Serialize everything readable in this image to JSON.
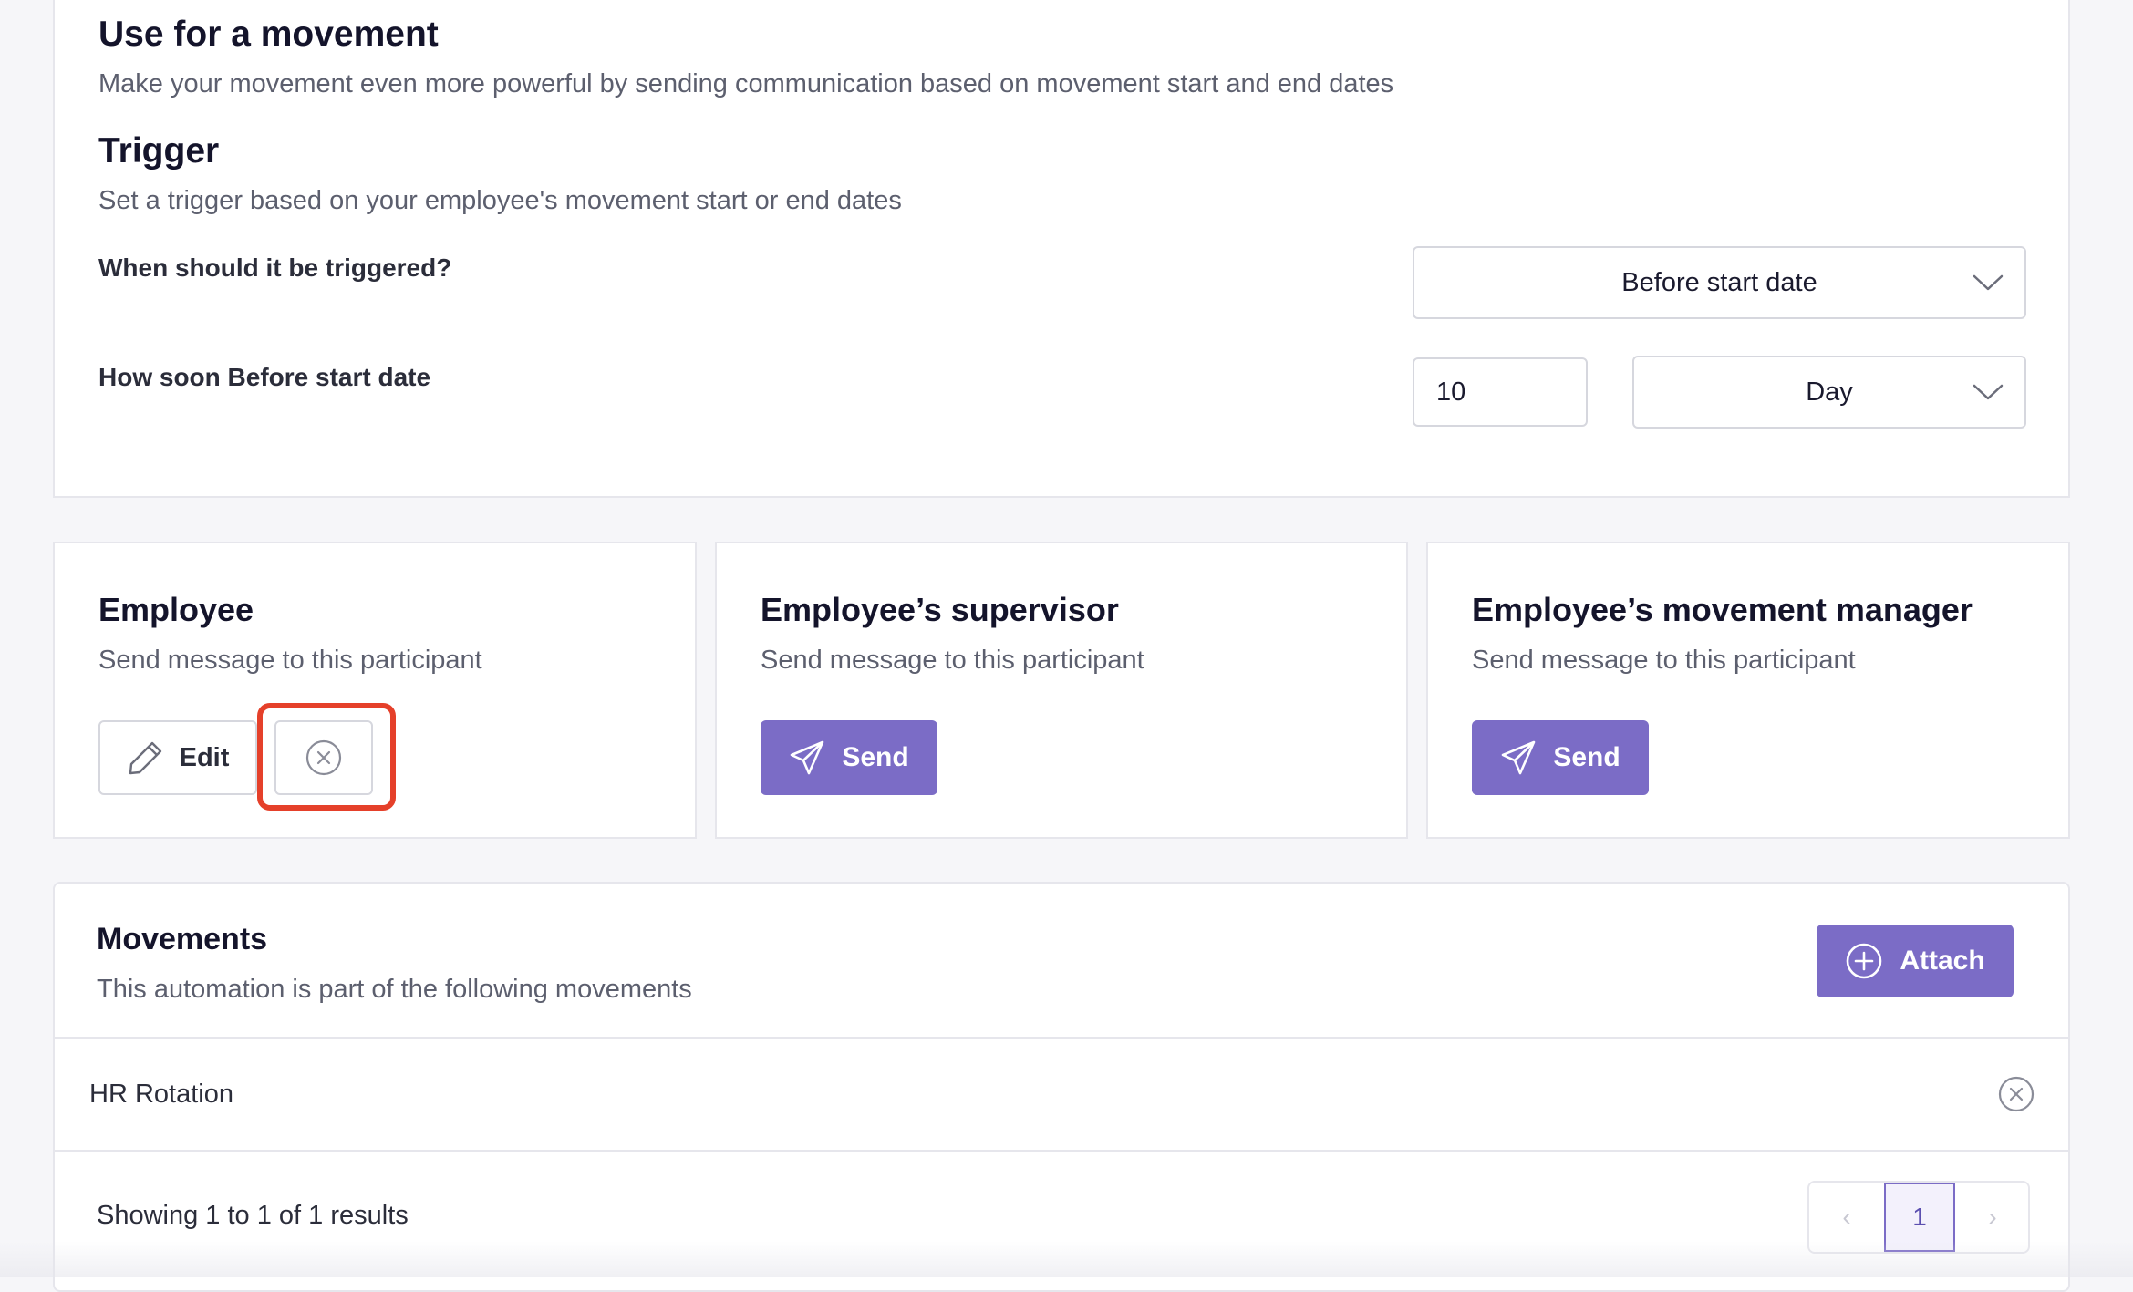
{
  "movement_section": {
    "title": "Use for a movement",
    "description": "Make your movement even more powerful by sending communication based on movement start and end dates",
    "trigger_title": "Trigger",
    "trigger_description": "Set a trigger based on your employee's movement start or end dates",
    "when_label": "When should it be triggered?",
    "when_value": "Before start date",
    "how_soon_label": "How soon Before start date",
    "how_soon_amount": "10",
    "how_soon_unit": "Day"
  },
  "participants": [
    {
      "title": "Employee",
      "description": "Send message to this participant",
      "edit_label": "Edit"
    },
    {
      "title": "Employee’s supervisor",
      "description": "Send message to this participant",
      "send_label": "Send"
    },
    {
      "title": "Employee’s movement manager",
      "description": "Send message to this participant",
      "send_label": "Send"
    }
  ],
  "movements": {
    "title": "Movements",
    "description": "This automation is part of the following movements",
    "attach_label": "Attach",
    "rows": [
      {
        "name": "HR Rotation"
      }
    ],
    "footer": "Showing 1 to 1 of 1 results",
    "pagination": {
      "prev": "‹",
      "current": "1",
      "next": "›"
    }
  },
  "colors": {
    "accent": "#7b6cc6",
    "highlight": "#e5402a"
  }
}
